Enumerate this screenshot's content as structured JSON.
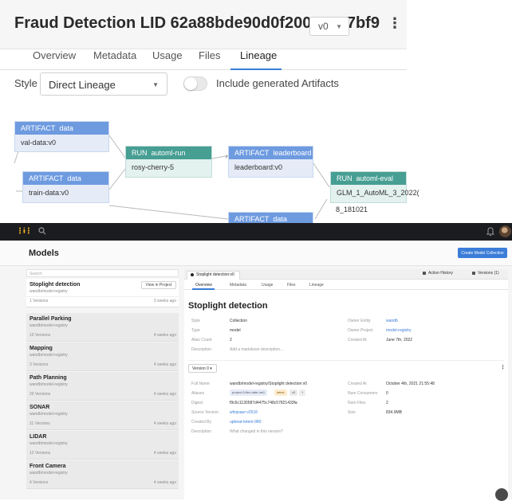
{
  "lineage_page": {
    "title": "Fraud Detection LID 62a88bde90d0f2003c6a7bf9",
    "version": "v0",
    "tabs": [
      "Overview",
      "Metadata",
      "Usage",
      "Files",
      "Lineage"
    ],
    "active_tab": "Lineage",
    "style_label": "Style",
    "style_value": "Direct Lineage",
    "toggle_label": "Include generated Artifacts",
    "toggle_on": false,
    "nodes": {
      "val_data": {
        "kind": "ARTIFACT",
        "name": "data",
        "value": "val-data:v0"
      },
      "train_data": {
        "kind": "ARTIFACT",
        "name": "data",
        "value": "train-data:v0"
      },
      "automl_run": {
        "kind": "RUN",
        "name": "automl-run",
        "value": "rosy-cherry-5"
      },
      "leaderboard": {
        "kind": "ARTIFACT",
        "name": "leaderboard",
        "value": "leaderboard:v0"
      },
      "automl_eval": {
        "kind": "RUN",
        "name": "automl-eval",
        "value": "GLM_1_AutoML_3_2022(",
        "extra": "8_181021"
      },
      "data_lower": {
        "kind": "ARTIFACT",
        "name": "data"
      }
    },
    "colors": {
      "artifact_header": "#6e9be0",
      "run_header": "#479e93",
      "tab_accent": "#3b7dd8"
    }
  },
  "app": {
    "logo": "⋮ɨ⋮",
    "page_title": "Models",
    "create_button": "Create Model Collection",
    "search_placeholder": "Search",
    "models": [
      {
        "name": "Stoplight detection",
        "path": "wandb/model-registry",
        "versions": "1 Versions",
        "time": "3 weeks ago",
        "selected": true,
        "view_btn": "View in Project"
      },
      {
        "name": "Parallel Parking",
        "path": "wandb/model-registry",
        "versions": "10 Versions",
        "time": "4 weeks ago"
      },
      {
        "name": "Mapping",
        "path": "wandb/model-registry",
        "versions": "3 Versions",
        "time": "4 weeks ago"
      },
      {
        "name": "Path Planning",
        "path": "wandb/model-registry",
        "versions": "20 Versions",
        "time": "4 weeks ago"
      },
      {
        "name": "SONAR",
        "path": "wandb/model-registry",
        "versions": "11 Versions",
        "time": "4 weeks ago"
      },
      {
        "name": "LIDAR",
        "path": "wandb/model-registry",
        "versions": "12 Versions",
        "time": "4 weeks ago"
      },
      {
        "name": "Front Camera",
        "path": "wandb/model-registry",
        "versions": "4 Versions",
        "time": "4 weeks ago"
      }
    ],
    "detail": {
      "tab_chip": "Stoplight detection:v0",
      "action_history": "Action History",
      "versions_btn": "Versions (1)",
      "sub_tabs": [
        "Overview",
        "Metadata",
        "Usage",
        "Files",
        "Lineage"
      ],
      "title": "Stoplight detection",
      "collection_fields": {
        "style_label": "Style",
        "style_value": "Collection",
        "type_label": "Type",
        "type_value": "model",
        "alias_label": "Alias Count",
        "alias_value": "2",
        "desc_label": "Description",
        "desc_value": "Add a markdown description...",
        "owner_entity_label": "Owner Entity",
        "owner_entity_value": "wandb",
        "owner_project_label": "Owner Project",
        "owner_project_value": "model-registry",
        "created_label": "Created At",
        "created_value": "June 7th, 2022"
      },
      "version_select": "Version 0",
      "version_fields": {
        "full_name_label": "Full Name",
        "full_name_value": "wandb/model-registry/Stoplight detection:v0",
        "aliases_label": "Aliases",
        "aliases": [
          "project-9-flex-date-ms1",
          "latest",
          "v0",
          "+"
        ],
        "digest_label": "Digest",
        "digest_value": "f9c6c1130587d4475c748c57821433fa",
        "source_label": "Source Version",
        "source_value": "wfxqvaer:v2516",
        "created_by_label": "Created By",
        "created_by_value": "upbeat-totem-980",
        "desc_label": "Description",
        "desc_value": "What changed in this version?",
        "created_at_label": "Created At",
        "created_at_value": "October 4th, 2021 21:55:48",
        "consumers_label": "Num Consumers",
        "consumers_value": "0",
        "files_label": "Num Files",
        "files_value": "2",
        "size_label": "Size",
        "size_value": "834.9MB"
      }
    }
  }
}
